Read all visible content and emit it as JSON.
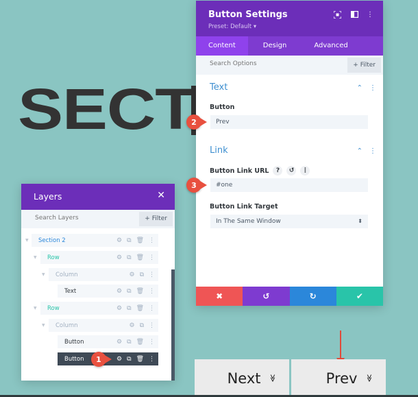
{
  "canvas": {
    "section_heading": "SECTI",
    "background_color": "#8ac5c2"
  },
  "settings_panel": {
    "title": "Button Settings",
    "preset": "Preset: Default ▾",
    "header_icons": [
      "fullscreen-icon",
      "split-view-icon",
      "more-icon"
    ],
    "tabs": [
      {
        "label": "Content",
        "active": true
      },
      {
        "label": "Design",
        "active": false
      },
      {
        "label": "Advanced",
        "active": false
      }
    ],
    "search_placeholder": "Search Options",
    "filter_label": "+ Filter",
    "groups": {
      "text": {
        "title": "Text",
        "fields": {
          "button_label": "Button",
          "button_value": "Prev"
        }
      },
      "link": {
        "title": "Link",
        "fields": {
          "url_label": "Button Link URL",
          "url_value": "#one",
          "target_label": "Button Link Target",
          "target_value": "In The Same Window"
        }
      }
    },
    "actions": [
      "cancel",
      "undo",
      "redo",
      "save"
    ],
    "colors": {
      "header": "#6c2eb9",
      "cancel": "#ef5555",
      "undo": "#7e3bd0",
      "redo": "#2b87da",
      "save": "#29c4a9"
    }
  },
  "layers_panel": {
    "title": "Layers",
    "search_placeholder": "Search Layers",
    "filter_label": "+ Filter",
    "items": [
      {
        "label": "Section 2",
        "type": "section"
      },
      {
        "label": "Row",
        "type": "row"
      },
      {
        "label": "Column",
        "type": "column"
      },
      {
        "label": "Text",
        "type": "module"
      },
      {
        "label": "Row",
        "type": "row"
      },
      {
        "label": "Column",
        "type": "column"
      },
      {
        "label": "Button",
        "type": "module"
      },
      {
        "label": "Button",
        "type": "module",
        "selected": true
      }
    ]
  },
  "callouts": [
    "1",
    "2",
    "3"
  ],
  "page_buttons": [
    {
      "label": "Next",
      "icon": "double-chevron-down-icon"
    },
    {
      "label": "Prev",
      "icon": "double-chevron-down-icon"
    }
  ]
}
